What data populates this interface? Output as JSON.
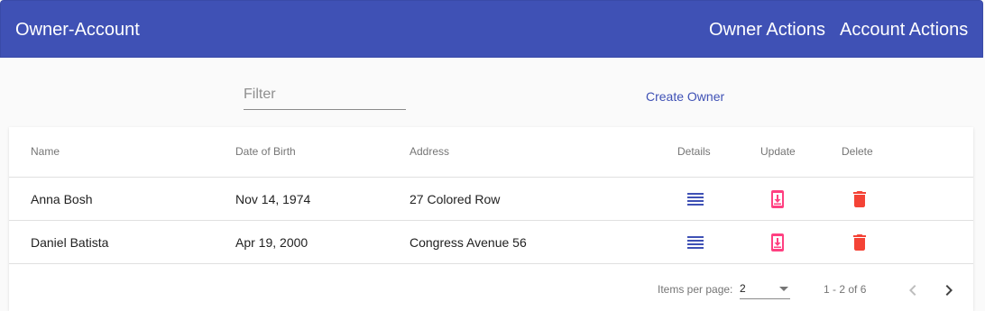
{
  "toolbar": {
    "title": "Owner-Account",
    "nav": {
      "owner_actions": "Owner Actions",
      "account_actions": "Account Actions"
    }
  },
  "filter": {
    "placeholder": "Filter",
    "value": ""
  },
  "create_owner_label": "Create Owner",
  "table": {
    "columns": {
      "name": "Name",
      "dob": "Date of Birth",
      "address": "Address",
      "details": "Details",
      "update": "Update",
      "delete": "Delete"
    },
    "rows": [
      {
        "name": "Anna Bosh",
        "dob": "Nov 14, 1974",
        "address": "27 Colored Row"
      },
      {
        "name": "Daniel Batista",
        "dob": "Apr 19, 2000",
        "address": "Congress Avenue 56"
      }
    ],
    "icons": {
      "details": "list-icon",
      "update": "update-icon",
      "delete": "delete-icon"
    }
  },
  "paginator": {
    "items_per_page_label": "Items per page:",
    "page_size": "2",
    "range_label": "1 - 2 of 6",
    "prev_icon": "chevron-left-icon",
    "next_icon": "chevron-right-icon"
  },
  "colors": {
    "primary": "#3f51b5",
    "accent": "#ff4081",
    "warn": "#f44336"
  }
}
